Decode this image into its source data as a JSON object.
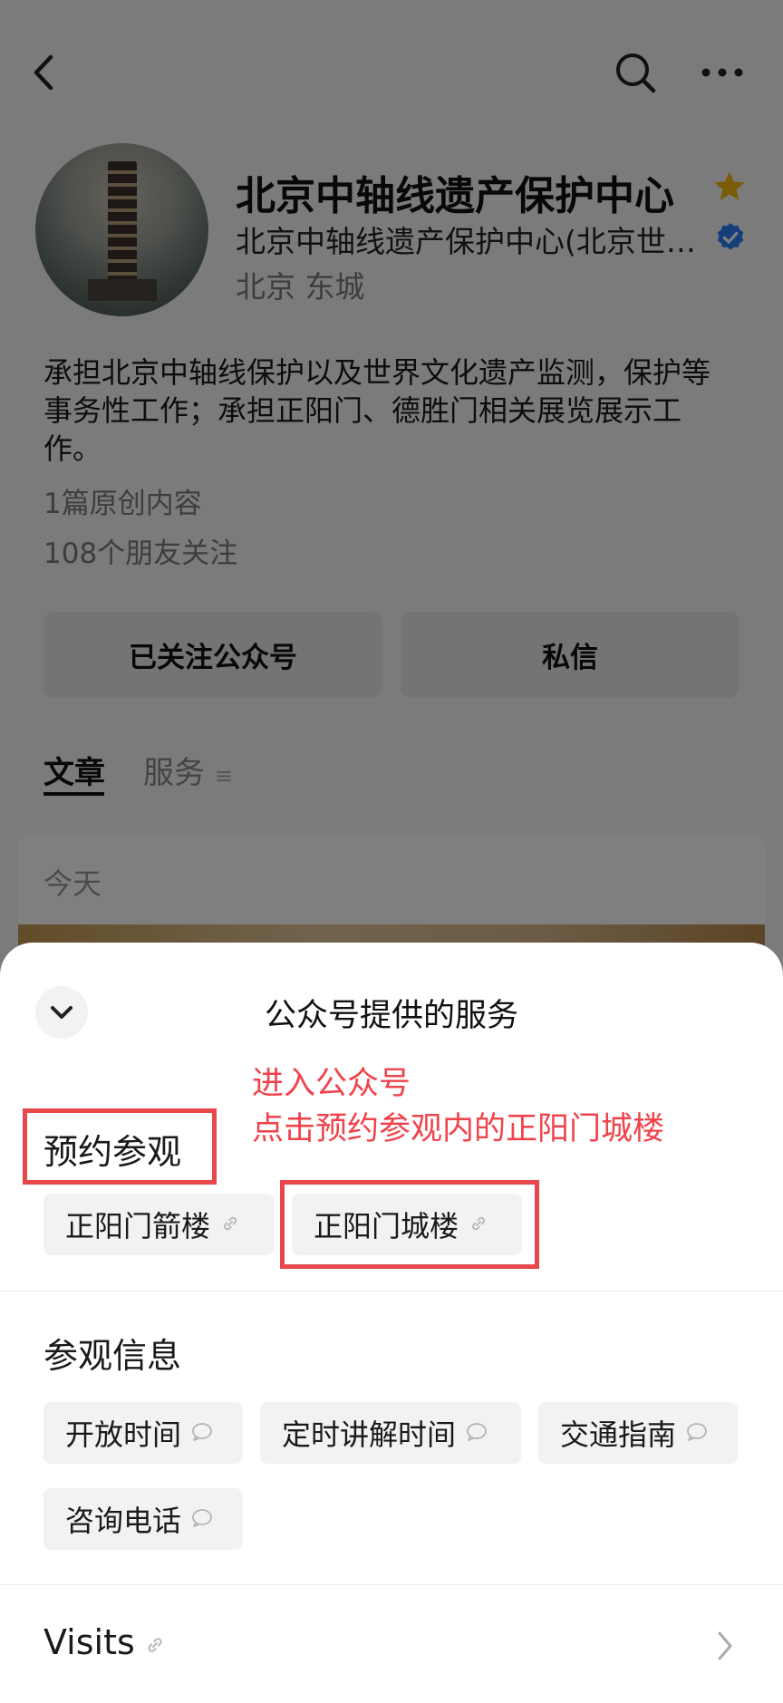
{
  "profile": {
    "name": "北京中轴线遗产保护中心",
    "subtitle": "北京中轴线遗产保护中心(北京世…",
    "location": "北京 东城",
    "description": "承担北京中轴线保护以及世界文化遗产监测，保护等事务性工作；承担正阳门、德胜门相关展览展示工作。",
    "original_count": "1篇原创内容",
    "friends_follow": "108个朋友关注",
    "star_color": "#f5b90d",
    "verified_color": "#2a7ff5"
  },
  "actions": {
    "follow_label": "已关注公众号",
    "message_label": "私信"
  },
  "tabs": [
    {
      "label": "文章"
    },
    {
      "label": "服务"
    }
  ],
  "feed": {
    "date_label": "今天"
  },
  "sheet": {
    "title": "公众号提供的服务",
    "annotation_line1": "进入公众号",
    "annotation_line2": "点击预约参观内的正阳门城楼",
    "booking_section": {
      "title": "预约参观",
      "items": [
        "正阳门箭楼",
        "正阳门城楼"
      ]
    },
    "info_section": {
      "title": "参观信息",
      "items": [
        "开放时间",
        "定时讲解时间",
        "交通指南",
        "咨询电话"
      ]
    },
    "visits_label": "Visits",
    "accent_red": "#e8474c"
  }
}
